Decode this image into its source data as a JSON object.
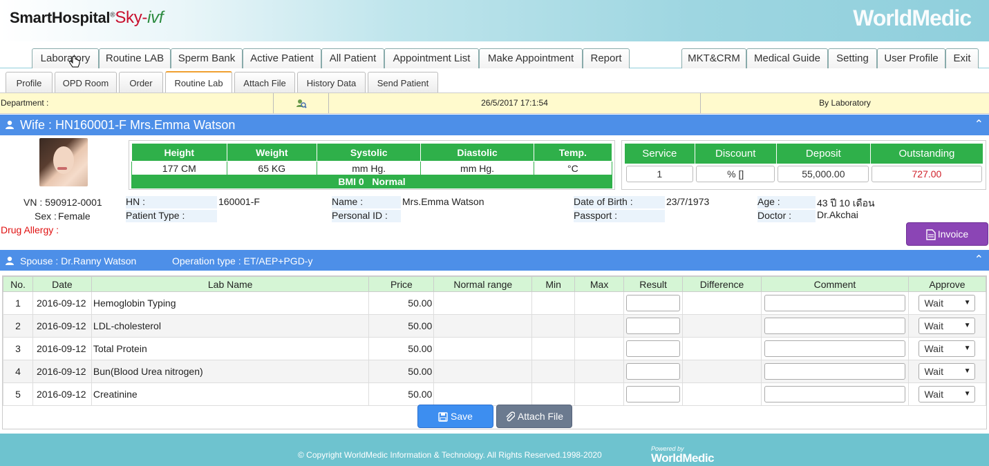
{
  "header": {
    "logo_main": "SmartHospital",
    "logo_reg": "®",
    "logo_sky": "Sky-",
    "logo_ivf": "ivf",
    "brand": "WorldMedic"
  },
  "main_tabs": [
    "Laboratory",
    "Routine LAB",
    "Sperm Bank",
    "Active Patient",
    "All Patient",
    "Appointment List",
    "Make Appointment",
    "Report",
    "MKT&CRM",
    "Medical Guide",
    "Setting",
    "User Profile",
    "Exit"
  ],
  "sub_tabs": [
    "Profile",
    "OPD Room",
    "Order",
    "Routine Lab",
    "Attach File",
    "History Data",
    "Send Patient"
  ],
  "infobar": {
    "department": "Department :",
    "datetime": "26/5/2017 17:1:54",
    "by": "By Laboratory"
  },
  "wife_header": "Wife : HN160001-F Mrs.Emma Watson",
  "vitals": {
    "headers": [
      "Height",
      "Weight",
      "Systolic",
      "Diastolic",
      "Temp."
    ],
    "values": [
      "177 CM",
      "65 KG",
      "mm Hg.",
      "mm Hg.",
      "°C"
    ],
    "bmi": "BMI 0   Normal"
  },
  "billing": {
    "headers": [
      "Service",
      "Discount",
      "Deposit",
      "Outstanding"
    ],
    "values": [
      "1",
      "% []",
      "55,000.00",
      "727.00"
    ],
    "outstanding_color": "#d0202a"
  },
  "patient": {
    "vn": "VN : 590912-0001",
    "sex_label": "Sex :",
    "sex": "Female",
    "drug_allergy": "Drug Allergy :",
    "hn_label": "HN :",
    "hn": "160001-F",
    "patient_type_label": "Patient Type :",
    "name_label": "Name :",
    "name": "Mrs.Emma Watson",
    "personal_id_label": "Personal ID :",
    "dob_label": "Date of Birth :",
    "dob": "23/7/1973",
    "passport_label": "Passport :",
    "age_label": "Age :",
    "age": "43 ปี 10 เดือน",
    "doctor_label": "Doctor :",
    "doctor": "Dr.Akchai",
    "invoice": "Invoice"
  },
  "spouse_header": {
    "spouse": "Spouse : Dr.Ranny Watson",
    "operation": "Operation type : ET/AEP+PGD-y"
  },
  "lab": {
    "columns": [
      "No.",
      "Date",
      "Lab Name",
      "Price",
      "Normal range",
      "Min",
      "Max",
      "Result",
      "Difference",
      "Comment",
      "Approve"
    ],
    "rows": [
      {
        "no": "1",
        "date": "2016-09-12",
        "name": "Hemoglobin Typing",
        "price": "50.00",
        "approve": "Wait"
      },
      {
        "no": "2",
        "date": "2016-09-12",
        "name": "LDL-cholesterol",
        "price": "50.00",
        "approve": "Wait"
      },
      {
        "no": "3",
        "date": "2016-09-12",
        "name": "Total Protein",
        "price": "50.00",
        "approve": "Wait"
      },
      {
        "no": "4",
        "date": "2016-09-12",
        "name": "Bun(Blood Urea nitrogen)",
        "price": "50.00",
        "approve": "Wait"
      },
      {
        "no": "5",
        "date": "2016-09-12",
        "name": "Creatinine",
        "price": "50.00",
        "approve": "Wait"
      }
    ],
    "save": "Save",
    "attach": "Attach File"
  },
  "footer": {
    "copyright": "© Copyright WorldMedic Information & Technology. All Rights Reserved.1998-2020",
    "powered": "Powered by",
    "powered_brand": "WorldMedic"
  },
  "colors": {
    "section_blue": "#4d8fe8",
    "vital_green": "#2fb04a",
    "invoice_purple": "#8b45b5",
    "save_blue": "#3d8ef0",
    "attach_gray": "#6b7a8f"
  }
}
